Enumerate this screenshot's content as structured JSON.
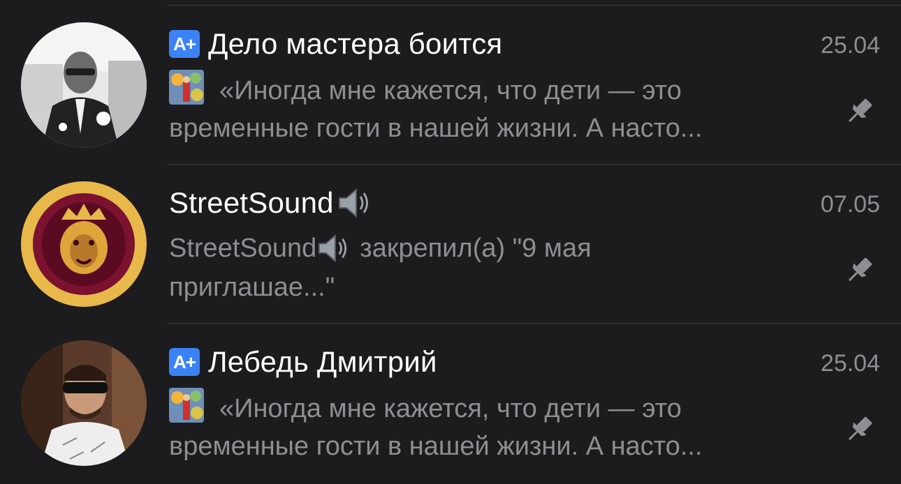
{
  "chats": [
    {
      "has_app_badge": true,
      "app_badge_text": "A+",
      "name": "Дело мастера боится",
      "date": "25.04",
      "preview_line1": "«Иногда мне кажется, что дети — это",
      "preview_line2": "временные гости в нашей жизни. А насто...",
      "pinned": true,
      "icons": [
        "avatar-photo",
        "thumbnail-image",
        "pin-icon"
      ]
    },
    {
      "has_app_badge": false,
      "name": "StreetSound",
      "date": "07.05",
      "preview_sender": "StreetSound",
      "preview_line1": "закрепил(а) \"9 мая",
      "preview_line2": "приглашае...\"",
      "pinned": true,
      "icons": [
        "streetsound-logo",
        "speaker-emoji-icon",
        "pin-icon"
      ]
    },
    {
      "has_app_badge": true,
      "app_badge_text": "A+",
      "name": "Лебедь Дмитрий",
      "date": "25.04",
      "preview_line1": "«Иногда мне кажется, что дети — это",
      "preview_line2": "временные гости в нашей жизни. А насто...",
      "pinned": true,
      "icons": [
        "avatar-photo",
        "thumbnail-image",
        "pin-icon"
      ]
    }
  ],
  "colors": {
    "background": "#1c1c1e",
    "name_text": "#ffffff",
    "secondary_text": "#8e8e93",
    "divider": "#3a3a3c",
    "badge_blue": "#3b82f6"
  }
}
